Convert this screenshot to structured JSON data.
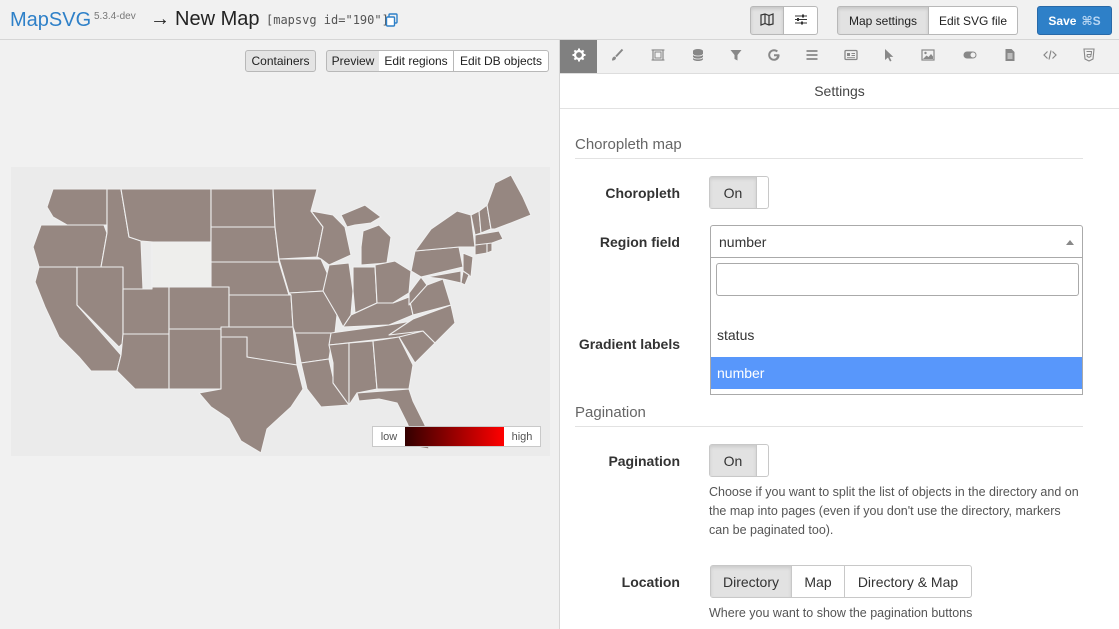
{
  "header": {
    "brand": "MapSVG",
    "version": "5.3.4-dev",
    "arrow": "→",
    "map_title": "New Map",
    "shortcode": "[mapsvg id=\"190\"]",
    "copy_icon": "copy-icon",
    "view_toggle_icons": [
      "map-icon",
      "sliders-icon"
    ],
    "map_settings_label": "Map settings",
    "edit_svg_label": "Edit SVG file",
    "save_label": "Save",
    "save_shortcut": "⌘S",
    "save_color": "#2e80c8"
  },
  "left_pane": {
    "containers_label": "Containers",
    "mode_buttons": [
      "Preview",
      "Edit regions",
      "Edit DB objects"
    ],
    "active_mode": "Preview",
    "region_color": "#968781",
    "highlighted_region_color": "#eeeeec",
    "legend": {
      "low_label": "low",
      "high_label": "high",
      "gradient_start": "#330000",
      "gradient_end": "#ff0000"
    }
  },
  "right_pane": {
    "tabs": [
      "gear-icon",
      "brush-icon",
      "frame-icon",
      "database-icon",
      "filter-icon",
      "google-icon",
      "list-icon",
      "id-card-icon",
      "cursor-icon",
      "image-icon",
      "toggle-icon",
      "file-icon",
      "code-icon",
      "css-icon"
    ],
    "active_tab": "gear-icon",
    "panel_title": "Settings",
    "choropleth_section": {
      "title": "Choropleth map",
      "choropleth_label": "Choropleth",
      "choropleth_value": "On",
      "region_field_label": "Region field",
      "region_field_value": "number",
      "dropdown_options": [
        "",
        "status",
        "number"
      ],
      "dropdown_selected": "number",
      "gradient_labels_label": "Gradient labels",
      "highlight_color": "#5897fb"
    },
    "pagination_section": {
      "title": "Pagination",
      "pagination_label": "Pagination",
      "pagination_value": "On",
      "pagination_desc": "Choose if you want to split the list of objects in the directory and on the map into pages (even if you don't use the directory, markers can be paginated too).",
      "location_label": "Location",
      "location_options": [
        "Directory",
        "Map",
        "Directory & Map"
      ],
      "location_selected": "Directory",
      "location_desc": "Where you want to show the pagination buttons"
    }
  }
}
